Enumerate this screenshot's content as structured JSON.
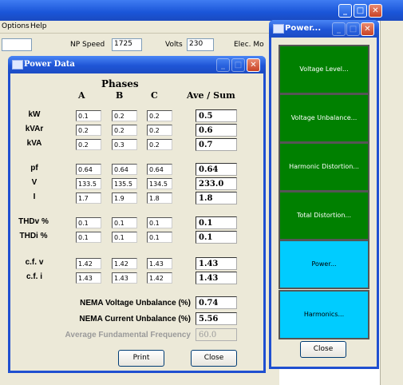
{
  "menu": {
    "options": "Options",
    "help": "Help"
  },
  "toolbar": {
    "np_speed_label": "NP Speed",
    "np_speed_value": "1725",
    "volts_label": "Volts",
    "volts_value": "230",
    "elec_label": "Elec. Mo"
  },
  "power_data": {
    "title": "Power Data",
    "phases_label": "Phases",
    "col_a": "A",
    "col_b": "B",
    "col_c": "C",
    "col_sum": "Ave / Sum",
    "rows": [
      {
        "label": "kW",
        "a": "0.1",
        "b": "0.2",
        "c": "0.2",
        "sum": "0.5"
      },
      {
        "label": "kVAr",
        "a": "0.2",
        "b": "0.2",
        "c": "0.2",
        "sum": "0.6"
      },
      {
        "label": "kVA",
        "a": "0.2",
        "b": "0.3",
        "c": "0.2",
        "sum": "0.7"
      },
      {
        "label": "pf",
        "a": "0.64",
        "b": "0.64",
        "c": "0.64",
        "sum": "0.64"
      },
      {
        "label": "V",
        "a": "133.5",
        "b": "135.5",
        "c": "134.5",
        "sum": "233.0"
      },
      {
        "label": "I",
        "a": "1.7",
        "b": "1.9",
        "c": "1.8",
        "sum": "1.8"
      },
      {
        "label": "THDv %",
        "a": "0.1",
        "b": "0.1",
        "c": "0.1",
        "sum": "0.1"
      },
      {
        "label": "THDi %",
        "a": "0.1",
        "b": "0.1",
        "c": "0.1",
        "sum": "0.1"
      },
      {
        "label": "c.f. v",
        "a": "1.42",
        "b": "1.42",
        "c": "1.43",
        "sum": "1.43"
      },
      {
        "label": "c.f. i",
        "a": "1.43",
        "b": "1.43",
        "c": "1.42",
        "sum": "1.43"
      }
    ],
    "nema_voltage_label": "NEMA Voltage Unbalance (%)",
    "nema_voltage_value": "0.74",
    "nema_current_label": "NEMA Current Unbalance (%)",
    "nema_current_value": "5.56",
    "avg_freq_label": "Average Fundamental Frequency",
    "avg_freq_value": "60.0",
    "print_label": "Print",
    "close_label": "Close"
  },
  "power_panel": {
    "title": "Power...",
    "buttons": [
      {
        "label": "Voltage Level...",
        "color": "#008000"
      },
      {
        "label": "Voltage Unbalance...",
        "color": "#008000"
      },
      {
        "label": "Harmonic Distortion...",
        "color": "#008000"
      },
      {
        "label": "Total Distortion...",
        "color": "#008000"
      },
      {
        "label": "Power...",
        "color": "#00ccff"
      },
      {
        "label": "Harmonics...",
        "color": "#00ccff"
      }
    ],
    "close_label": "Close"
  },
  "colors": {
    "title_bar": "#1f55d6",
    "window_bg": "#ece9d8",
    "green": "#008000",
    "cyan": "#00ccff"
  }
}
